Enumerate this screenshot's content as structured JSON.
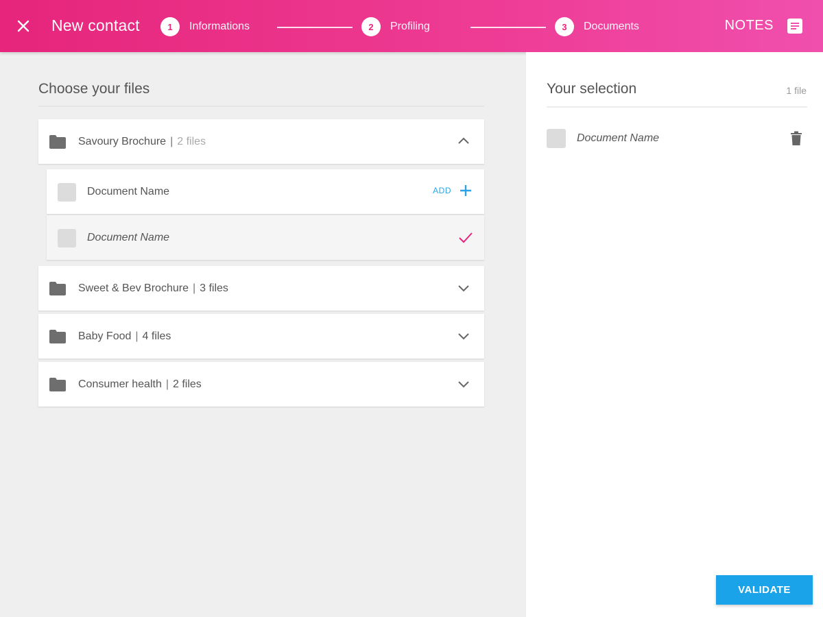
{
  "header": {
    "title": "New contact",
    "steps": [
      {
        "num": "1",
        "label": "Informations"
      },
      {
        "num": "2",
        "label": "Profiling"
      },
      {
        "num": "3",
        "label": "Documents"
      }
    ],
    "notes_label": "NOTES",
    "close_icon": "close-icon",
    "notes_icon": "notes-icon"
  },
  "left": {
    "title": "Choose your files",
    "folders": [
      {
        "name": "Savoury Brochure",
        "sep": "|",
        "count": "2 files",
        "expanded": true
      },
      {
        "name": "Sweet & Bev Brochure",
        "sep": "|",
        "count": "3 files",
        "expanded": false
      },
      {
        "name": "Baby Food",
        "sep": "|",
        "count": "4 files",
        "expanded": false
      },
      {
        "name": "Consumer health",
        "sep": "|",
        "count": "2 files",
        "expanded": false
      }
    ],
    "documents": [
      {
        "name": "Document Name",
        "action_label": "ADD",
        "selected": false
      },
      {
        "name": "Document Name",
        "selected": true
      }
    ]
  },
  "right": {
    "title": "Your selection",
    "count": "1 file",
    "items": [
      {
        "name": "Document Name"
      }
    ],
    "validate_label": "VALIDATE"
  },
  "colors": {
    "brand": "#e6257b",
    "accent_blue": "#1aa3e8",
    "check_pink": "#e6257b"
  }
}
